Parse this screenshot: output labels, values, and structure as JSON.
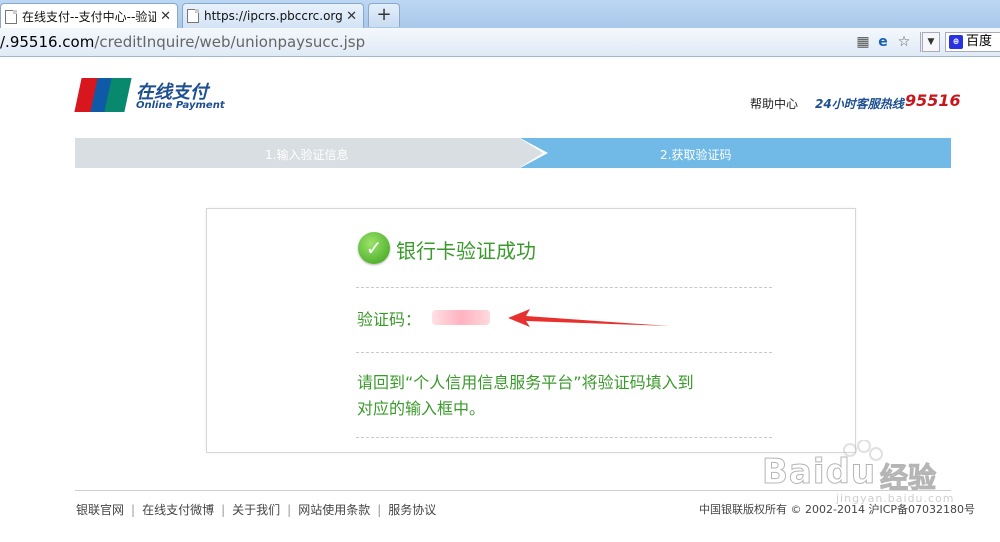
{
  "browser": {
    "tabs": [
      {
        "title": "在线支付--支付中心--验证成",
        "active": true
      },
      {
        "title": "https://ipcrs.pbccrc.org.cn",
        "active": false
      }
    ],
    "new_tab_label": "+",
    "url_host": "/.95516.com",
    "url_path": "/creditInquire/web/unionpaysucc.jsp",
    "search_text": "百度",
    "icons": [
      "qr-icon",
      "compat-icon",
      "star-icon",
      "dropdown-icon",
      "baidu-icon"
    ]
  },
  "header": {
    "logo_badge": "UnionPay 银联",
    "logo_cn": "在线支付",
    "logo_en": "Online Payment",
    "help": "帮助中心",
    "hotline_label": "24小时客服热线",
    "hotline_number": "95516"
  },
  "steps": [
    {
      "label": "1.输入验证信息",
      "active": false
    },
    {
      "label": "2.获取验证码",
      "active": true
    }
  ],
  "result": {
    "title": "银行卡验证成功",
    "code_label": "验证码：",
    "instruction_line1": "请回到“个人信用信息服务平台”将验证码填入到",
    "instruction_line2": "对应的输入框中。"
  },
  "footer": {
    "links": [
      "银联官网",
      "在线支付微博",
      "关于我们",
      "网站使用条款",
      "服务协议"
    ],
    "copyright": "中国银联版权所有 © 2002-2014 沪ICP备07032180号"
  },
  "watermark": {
    "text": "Bai",
    "text2": "du",
    "cn": "经验",
    "sub": "jingyan.baidu.com"
  },
  "colors": {
    "success_green": "#3b9a2c",
    "step_active": "#71b9e6",
    "step_inactive": "#d9dee2",
    "hotline_red": "#c8161d",
    "brand_blue": "#1d4f91"
  }
}
